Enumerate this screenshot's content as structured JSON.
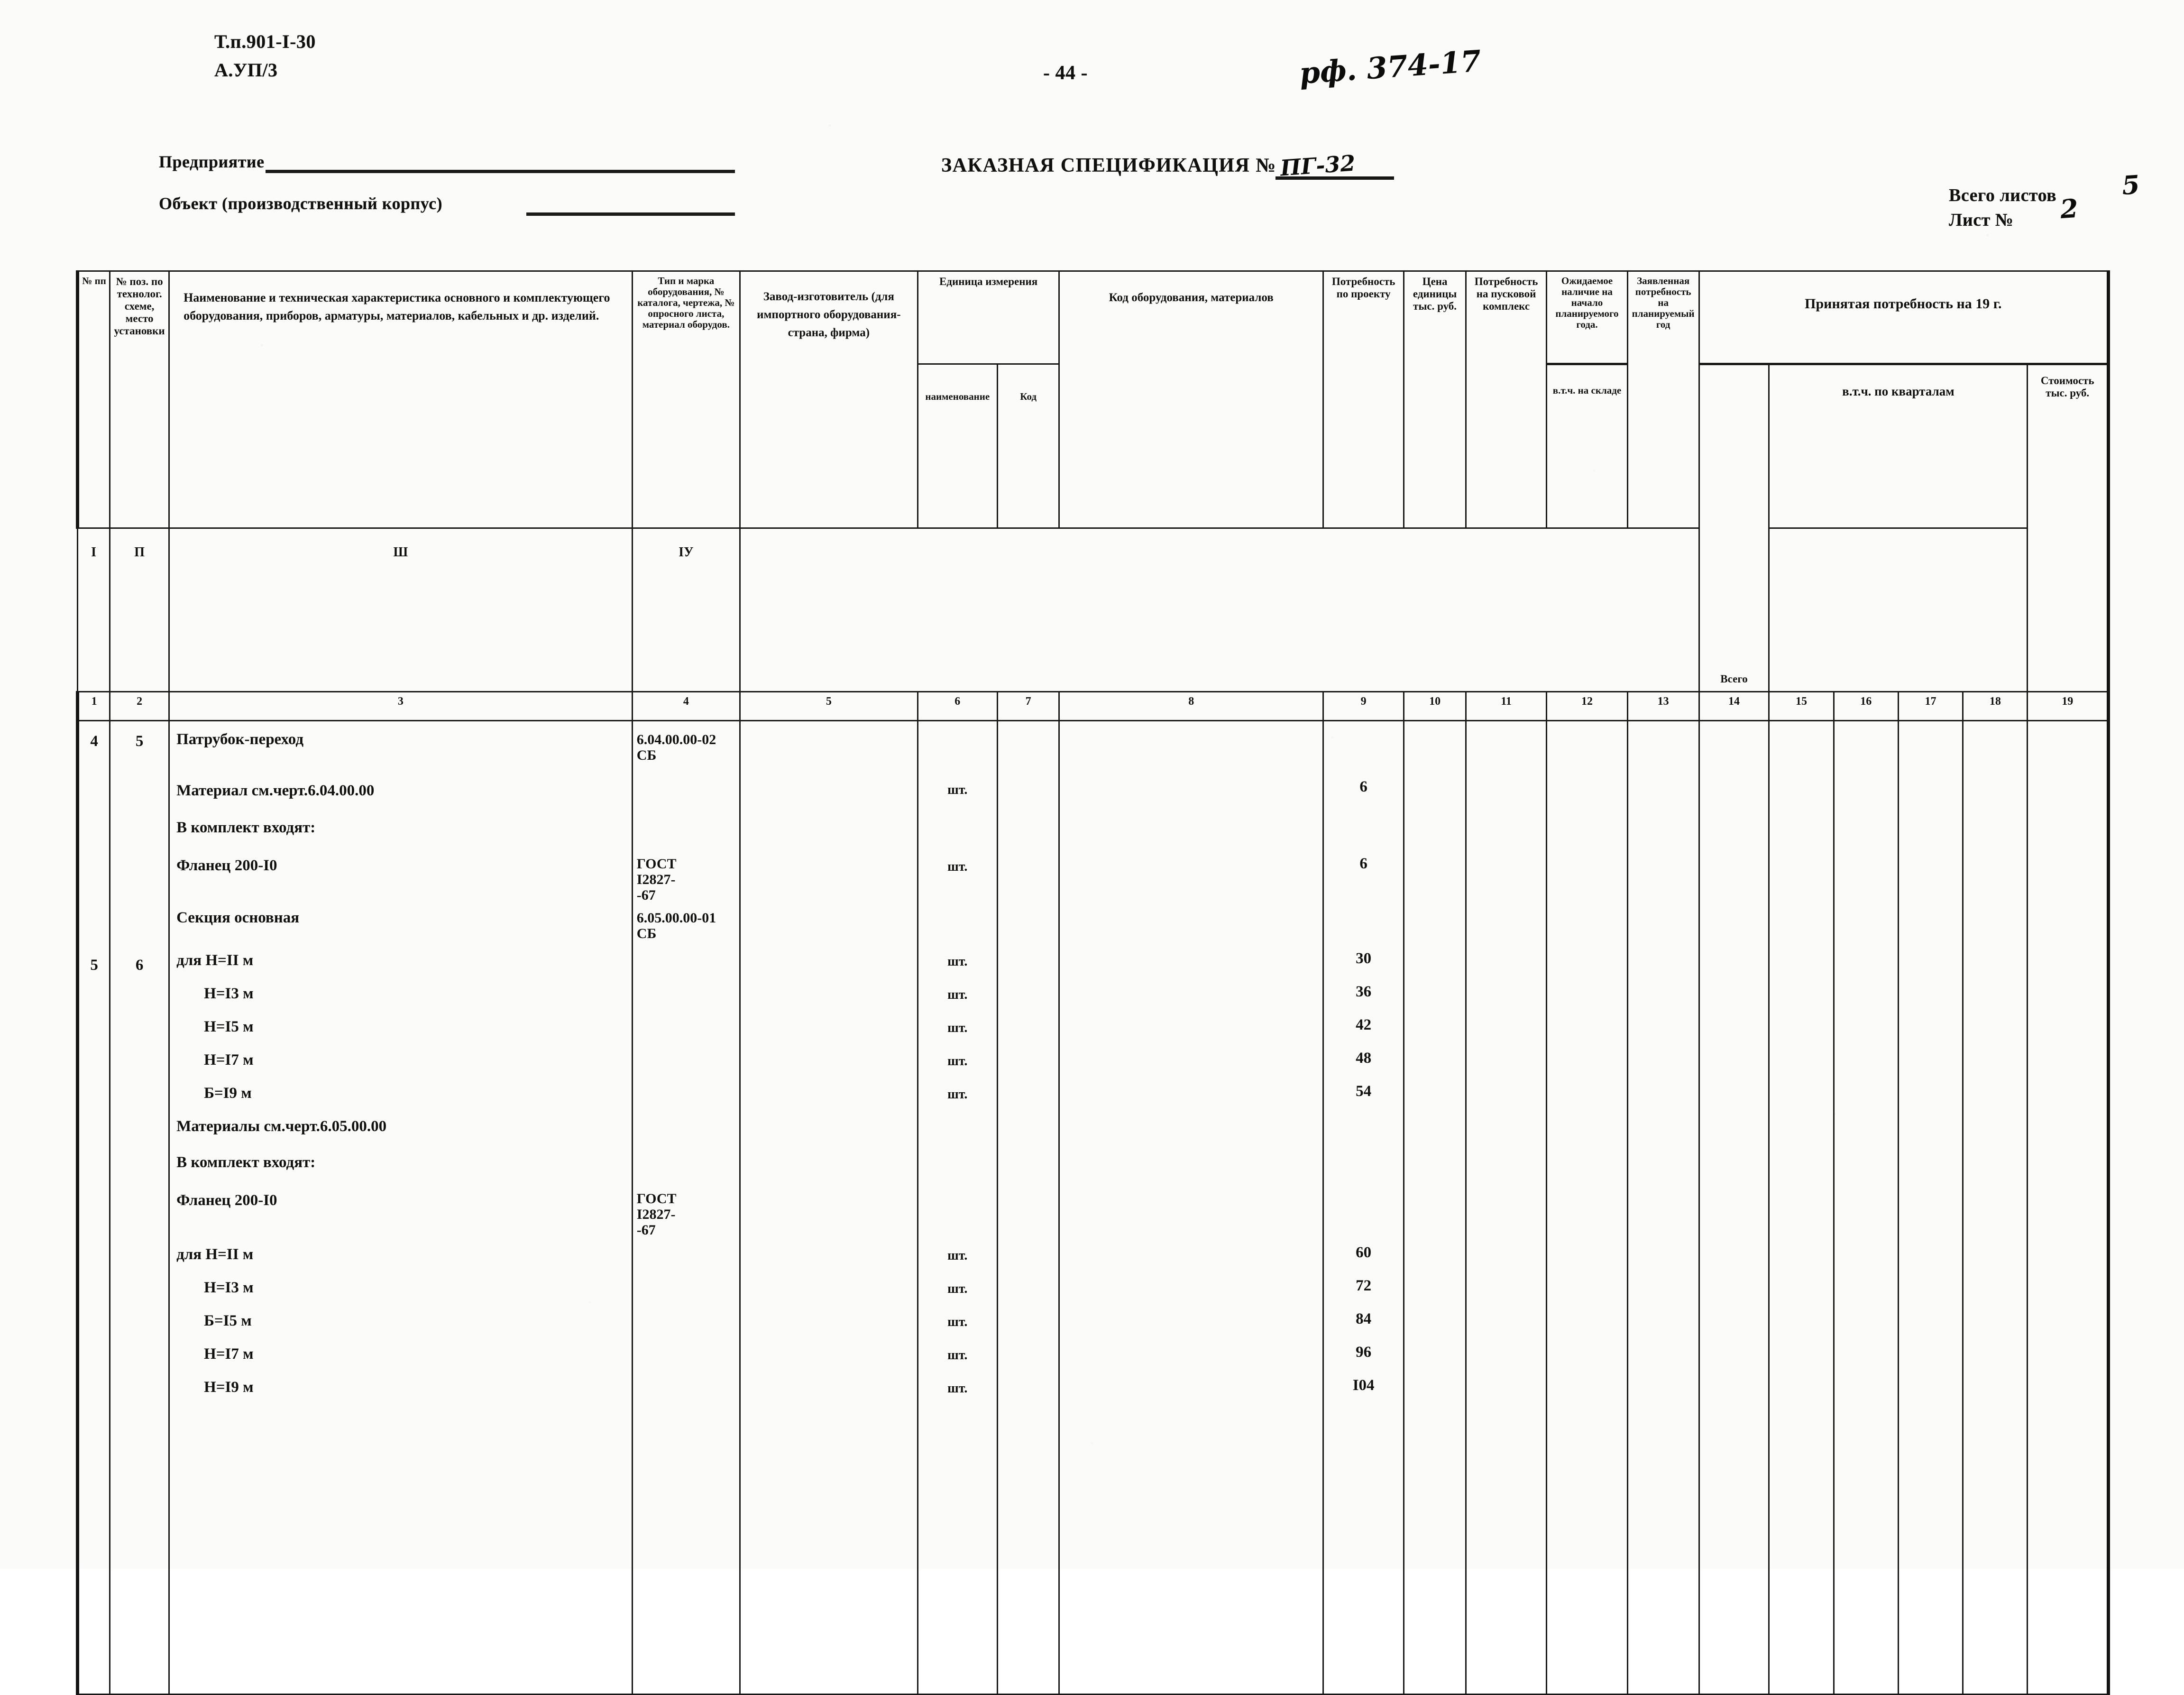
{
  "header": {
    "doc_code": "Т.п.901-I-30",
    "sheet_index": "А.УП/3",
    "page_number": "- 44 -",
    "ref_stamp": "рф. 374-17",
    "spec_title": "ЗАКАЗНАЯ СПЕЦИФИКАЦИЯ №",
    "spec_number": "ПГ-32",
    "field_enterprise": "Предприятие",
    "field_object": "Объект (производственный корпус)",
    "sheets_total_label": "Всего листов",
    "sheets_total_value": "5",
    "sheet_no_label": "Лист №",
    "sheet_no_value": "2"
  },
  "table": {
    "columns": [
      {
        "num": "1",
        "title": "№ пп"
      },
      {
        "num": "2",
        "title": "№ поз. по технолог. схеме, место установки"
      },
      {
        "num": "3",
        "title": "Наименование и техническая характеристика основного и комплектующего оборудования, приборов, арматуры, материалов, кабельных и др. изделий."
      },
      {
        "num": "4",
        "title": "Тип и марка оборудования, № каталога, чертежа, № опросного листа, материал оборудов."
      },
      {
        "num": "5",
        "title": "Завод-изготовитель (для импортного оборудования-страна, фирма)"
      },
      {
        "num": "6",
        "title": "наименование"
      },
      {
        "num": "7",
        "title": "Код"
      },
      {
        "num": "8",
        "title": "Код оборудования, материалов"
      },
      {
        "num": "9",
        "title": "Потребность по проекту"
      },
      {
        "num": "10",
        "title": "Цена единицы тыс. руб."
      },
      {
        "num": "11",
        "title": "Потребность на пусковой комплекс"
      },
      {
        "num": "12",
        "title": "в.т.ч. на складе"
      },
      {
        "num": "13",
        "title": "Заявленная потребность на планируемый год"
      },
      {
        "num": "14",
        "title": "Всего"
      },
      {
        "num": "15",
        "title": "I"
      },
      {
        "num": "16",
        "title": "П"
      },
      {
        "num": "17",
        "title": "Ш"
      },
      {
        "num": "18",
        "title": "IУ"
      },
      {
        "num": "19",
        "title": "Стоимость тыс. руб."
      }
    ],
    "group_headers": {
      "unit_of_measure": "Единица измерения",
      "expected_stock": "Ожидаемое наличие на начало планируемого года.",
      "accepted_need": "Принятая потребность на 19          г.",
      "by_quarters": "в.т.ч. по кварталам"
    },
    "rows": [
      {
        "nn": "4",
        "pos": "5",
        "name_lines": [
          "Патрубок-переход",
          "Материал см.черт.6.04.00.00",
          "В комплект входят:",
          "Фланец 200-I0"
        ],
        "mark_lines": [
          "6.04.00.00-02",
          "СБ",
          "ГОСТ",
          "I2827-",
          "-67"
        ],
        "unit_lines": [
          "шт.",
          "шт."
        ],
        "qty_lines": [
          "6",
          "6"
        ]
      },
      {
        "nn": "5",
        "pos": "6",
        "name_lines": [
          "Секция основная",
          "для Н=II м",
          "Н=I3 м",
          "Н=I5 м",
          "Н=I7 м",
          "Б=I9 м",
          "Материалы см.черт.6.05.00.00",
          "В комплект входят:",
          "Фланец 200-I0",
          "для Н=II м",
          "Н=I3 м",
          "Б=I5 м",
          "Н=I7 м",
          "Н=I9 м"
        ],
        "mark_lines": [
          "6.05.00.00-01",
          "СБ",
          "ГОСТ",
          "I2827-",
          "-67"
        ],
        "unit_lines": [
          "шт.",
          "шт.",
          "шт.",
          "шт.",
          "шт.",
          "шт.",
          "шт.",
          "шт.",
          "шт.",
          "шт."
        ],
        "qty_lines": [
          "30",
          "36",
          "42",
          "48",
          "54",
          "60",
          "72",
          "84",
          "96",
          "I04"
        ]
      }
    ]
  }
}
